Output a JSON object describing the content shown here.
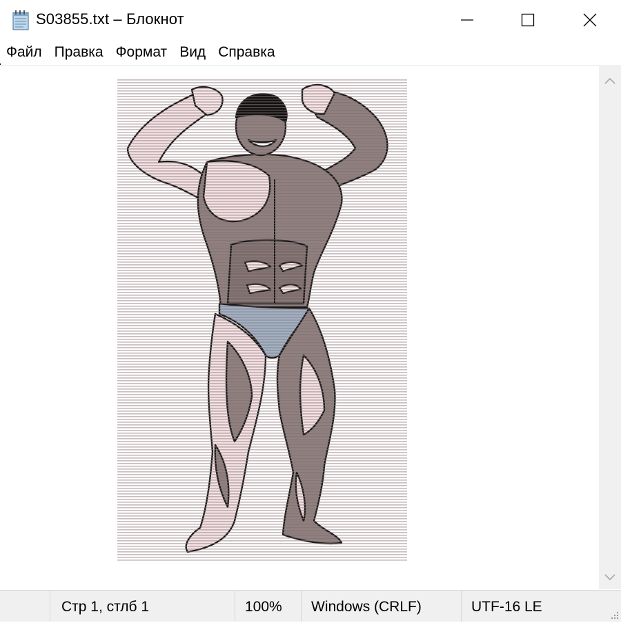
{
  "window": {
    "title": "S03855.txt – Блокнот",
    "icon": "notepad-icon",
    "controls": [
      "minimize-icon",
      "maximize-icon",
      "close-icon"
    ]
  },
  "menu": {
    "items": [
      {
        "label": "Файл"
      },
      {
        "label": "Правка"
      },
      {
        "label": "Формат"
      },
      {
        "label": "Вид"
      },
      {
        "label": "Справка"
      }
    ]
  },
  "editor": {
    "content": "ascii-art-bodybuilder",
    "colors": {
      "skin_light": "#f6e4e6",
      "skin_dark": "#8d7f7d",
      "outline": "#1a1a1a",
      "trunks": "#9fb1c4",
      "hair": "#111111"
    }
  },
  "scrollbar": {
    "up_icon": "chevron-up-icon",
    "down_icon": "chevron-down-icon"
  },
  "status": {
    "position": "Стр 1, стлб 1",
    "zoom": "100%",
    "line_endings": "Windows (CRLF)",
    "encoding": "UTF-16 LE"
  }
}
